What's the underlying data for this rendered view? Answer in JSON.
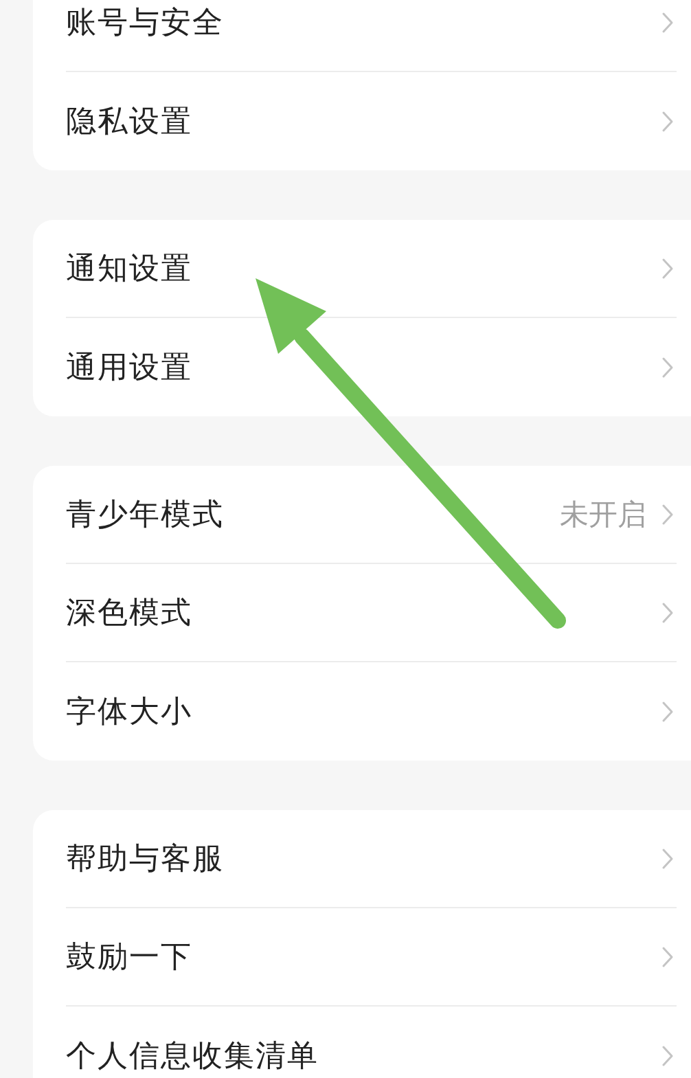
{
  "sections": [
    {
      "items": [
        {
          "label": "账号与安全"
        },
        {
          "label": "隐私设置"
        }
      ]
    },
    {
      "items": [
        {
          "label": "通知设置"
        },
        {
          "label": "通用设置"
        }
      ]
    },
    {
      "items": [
        {
          "label": "青少年模式",
          "value": "未开启"
        },
        {
          "label": "深色模式"
        },
        {
          "label": "字体大小"
        }
      ]
    },
    {
      "items": [
        {
          "label": "帮助与客服"
        },
        {
          "label": "鼓励一下"
        },
        {
          "label": "个人信息收集清单"
        }
      ]
    }
  ]
}
